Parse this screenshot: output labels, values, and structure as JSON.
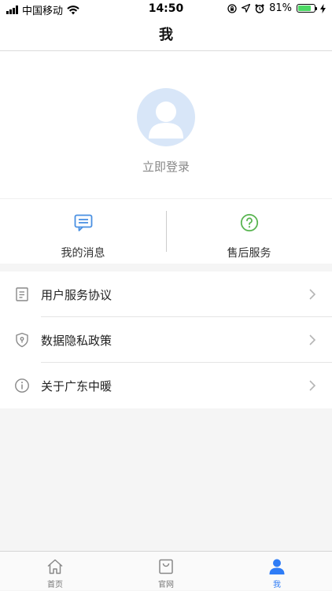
{
  "status_bar": {
    "carrier": "中国移动",
    "time": "14:50",
    "battery": "81%",
    "battery_level": 0.81,
    "icons": [
      "signal-icon",
      "wifi-icon",
      "screen-lock-icon",
      "location-icon",
      "alarm-icon",
      "battery-icon",
      "charging-icon"
    ]
  },
  "header": {
    "title": "我"
  },
  "profile": {
    "login_label": "立即登录",
    "avatar_icon": "default-avatar-icon"
  },
  "actions": [
    {
      "label": "我的消息",
      "icon": "message-icon",
      "color": "#4a90e2"
    },
    {
      "label": "售后服务",
      "icon": "question-circle-icon",
      "color": "#5ab552"
    }
  ],
  "menu": [
    {
      "label": "用户服务协议",
      "icon": "document-icon"
    },
    {
      "label": "数据隐私政策",
      "icon": "shield-icon"
    },
    {
      "label": "关于广东中暖",
      "icon": "info-circle-icon"
    }
  ],
  "tabbar": {
    "tabs": [
      {
        "label": "首页",
        "icon": "home-icon"
      },
      {
        "label": "官网",
        "icon": "shop-bag-icon"
      },
      {
        "label": "我",
        "icon": "user-icon"
      }
    ],
    "active_index": 2,
    "active_color": "#2e7cf6",
    "inactive_color": "#888888"
  }
}
